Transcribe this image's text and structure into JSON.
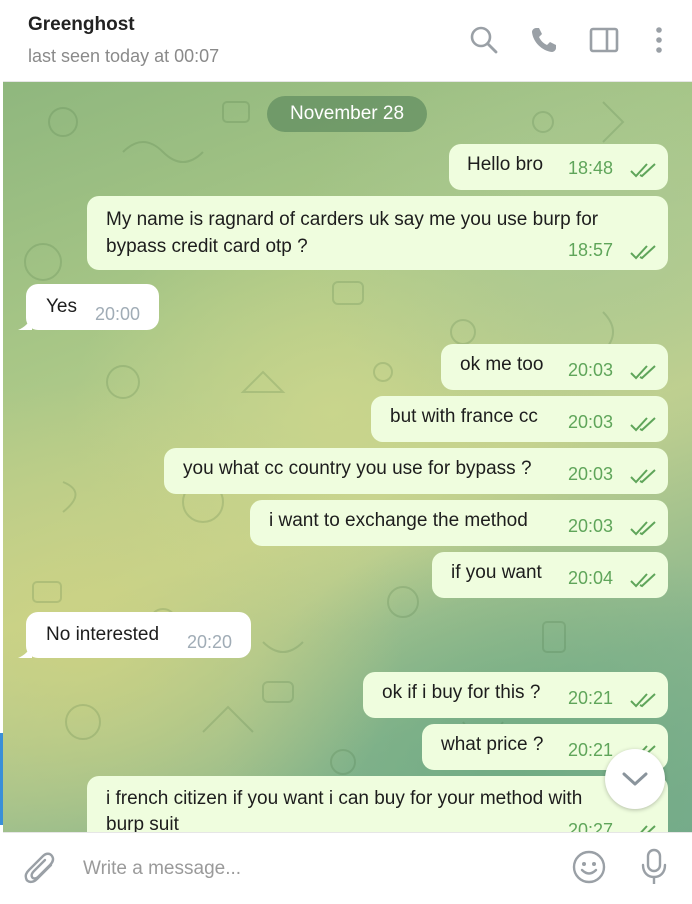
{
  "header": {
    "name": "Greenghost",
    "status": "last seen today at 00:07"
  },
  "icons": {
    "search": "search-icon",
    "call": "phone-icon",
    "sidebar": "sidebar-toggle-icon",
    "menu": "more-vertical-icon",
    "attach": "paperclip-icon",
    "emoji": "emoji-icon",
    "mic": "microphone-icon",
    "scroll": "chevron-down-icon",
    "read": "double-check-icon"
  },
  "colors": {
    "outgoing_bubble": "#effdde",
    "incoming_bubble": "#ffffff",
    "time_out": "#5fa55a",
    "time_in": "#a0acb6",
    "date_pill": "#608c60"
  },
  "chat": {
    "date": "November 28",
    "messages": [
      {
        "dir": "out",
        "lines": [
          "Hello bro"
        ],
        "time": "18:48"
      },
      {
        "dir": "out",
        "lines": [
          "My name is ragnard of carders uk say me you use burp for",
          "bypass credit card otp ?"
        ],
        "time": "18:57"
      },
      {
        "dir": "in",
        "lines": [
          "Yes"
        ],
        "time": "20:00"
      },
      {
        "dir": "out",
        "lines": [
          "ok me too"
        ],
        "time": "20:03"
      },
      {
        "dir": "out",
        "lines": [
          "but with france cc"
        ],
        "time": "20:03"
      },
      {
        "dir": "out",
        "lines": [
          "you what cc country you use for bypass ?"
        ],
        "time": "20:03"
      },
      {
        "dir": "out",
        "lines": [
          "i want to exchange the method"
        ],
        "time": "20:03"
      },
      {
        "dir": "out",
        "lines": [
          "if you want"
        ],
        "time": "20:04"
      },
      {
        "dir": "in",
        "lines": [
          "No interested"
        ],
        "time": "20:20"
      },
      {
        "dir": "out",
        "lines": [
          "ok if i buy for this ?"
        ],
        "time": "20:21"
      },
      {
        "dir": "out",
        "lines": [
          "what price ?"
        ],
        "time": "20:21"
      },
      {
        "dir": "out",
        "lines": [
          "i french citizen if you want i can buy for your method with",
          "burp suit"
        ],
        "time": "20:27"
      }
    ]
  },
  "composer": {
    "placeholder": "Write a message..."
  }
}
